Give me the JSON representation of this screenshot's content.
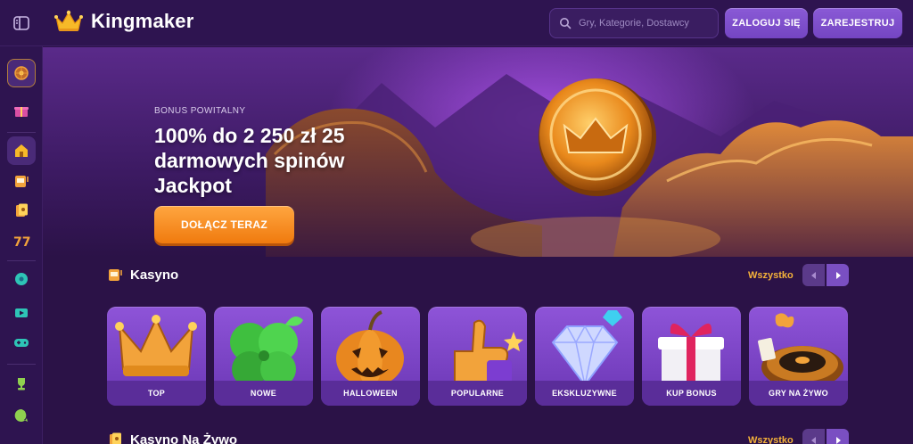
{
  "header": {
    "brand": "Kingmaker",
    "search_placeholder": "Gry, Kategorie, Dostawcy",
    "login_label": "ZALOGUJ SIĘ",
    "register_label": "ZAREJESTRUJ"
  },
  "sidebar": {
    "items": [
      {
        "icon": "wheel-icon"
      },
      {
        "icon": "gift-icon"
      },
      {
        "icon": "home-icon"
      },
      {
        "icon": "slot-machine-icon"
      },
      {
        "icon": "cards-icon"
      },
      {
        "icon": "sevens-icon"
      },
      {
        "icon": "ball-icon"
      },
      {
        "icon": "live-video-icon"
      },
      {
        "icon": "gamepad-icon"
      },
      {
        "icon": "trophy-icon"
      },
      {
        "icon": "chat-icon"
      }
    ]
  },
  "hero": {
    "subtitle": "BONUS POWITALNY",
    "title": "100% do 2 250 zł 25 darmowych spinów Jackpot",
    "cta_label": "DOŁĄCZ TERAZ"
  },
  "casino": {
    "title": "Kasyno",
    "see_all": "Wszystko",
    "tiles": [
      {
        "label": "TOP",
        "icon": "crown-icon"
      },
      {
        "label": "NOWE",
        "icon": "clover-icon"
      },
      {
        "label": "HALLOWEEN",
        "icon": "pumpkin-icon"
      },
      {
        "label": "POPULARNE",
        "icon": "thumbs-up-icon"
      },
      {
        "label": "EKSKLUZYWNE",
        "icon": "diamond-icon"
      },
      {
        "label": "KUP BONUS",
        "icon": "gift-box-icon"
      },
      {
        "label": "GRY NA ŻYWO",
        "icon": "roulette-icon"
      }
    ]
  },
  "live_casino": {
    "title": "Kasyno Na Żywo",
    "see_all": "Wszystko"
  },
  "colors": {
    "background": "#2b1247",
    "accent": "#7a4fc2",
    "cta": "#f07a0e",
    "link": "#f5b23a"
  }
}
